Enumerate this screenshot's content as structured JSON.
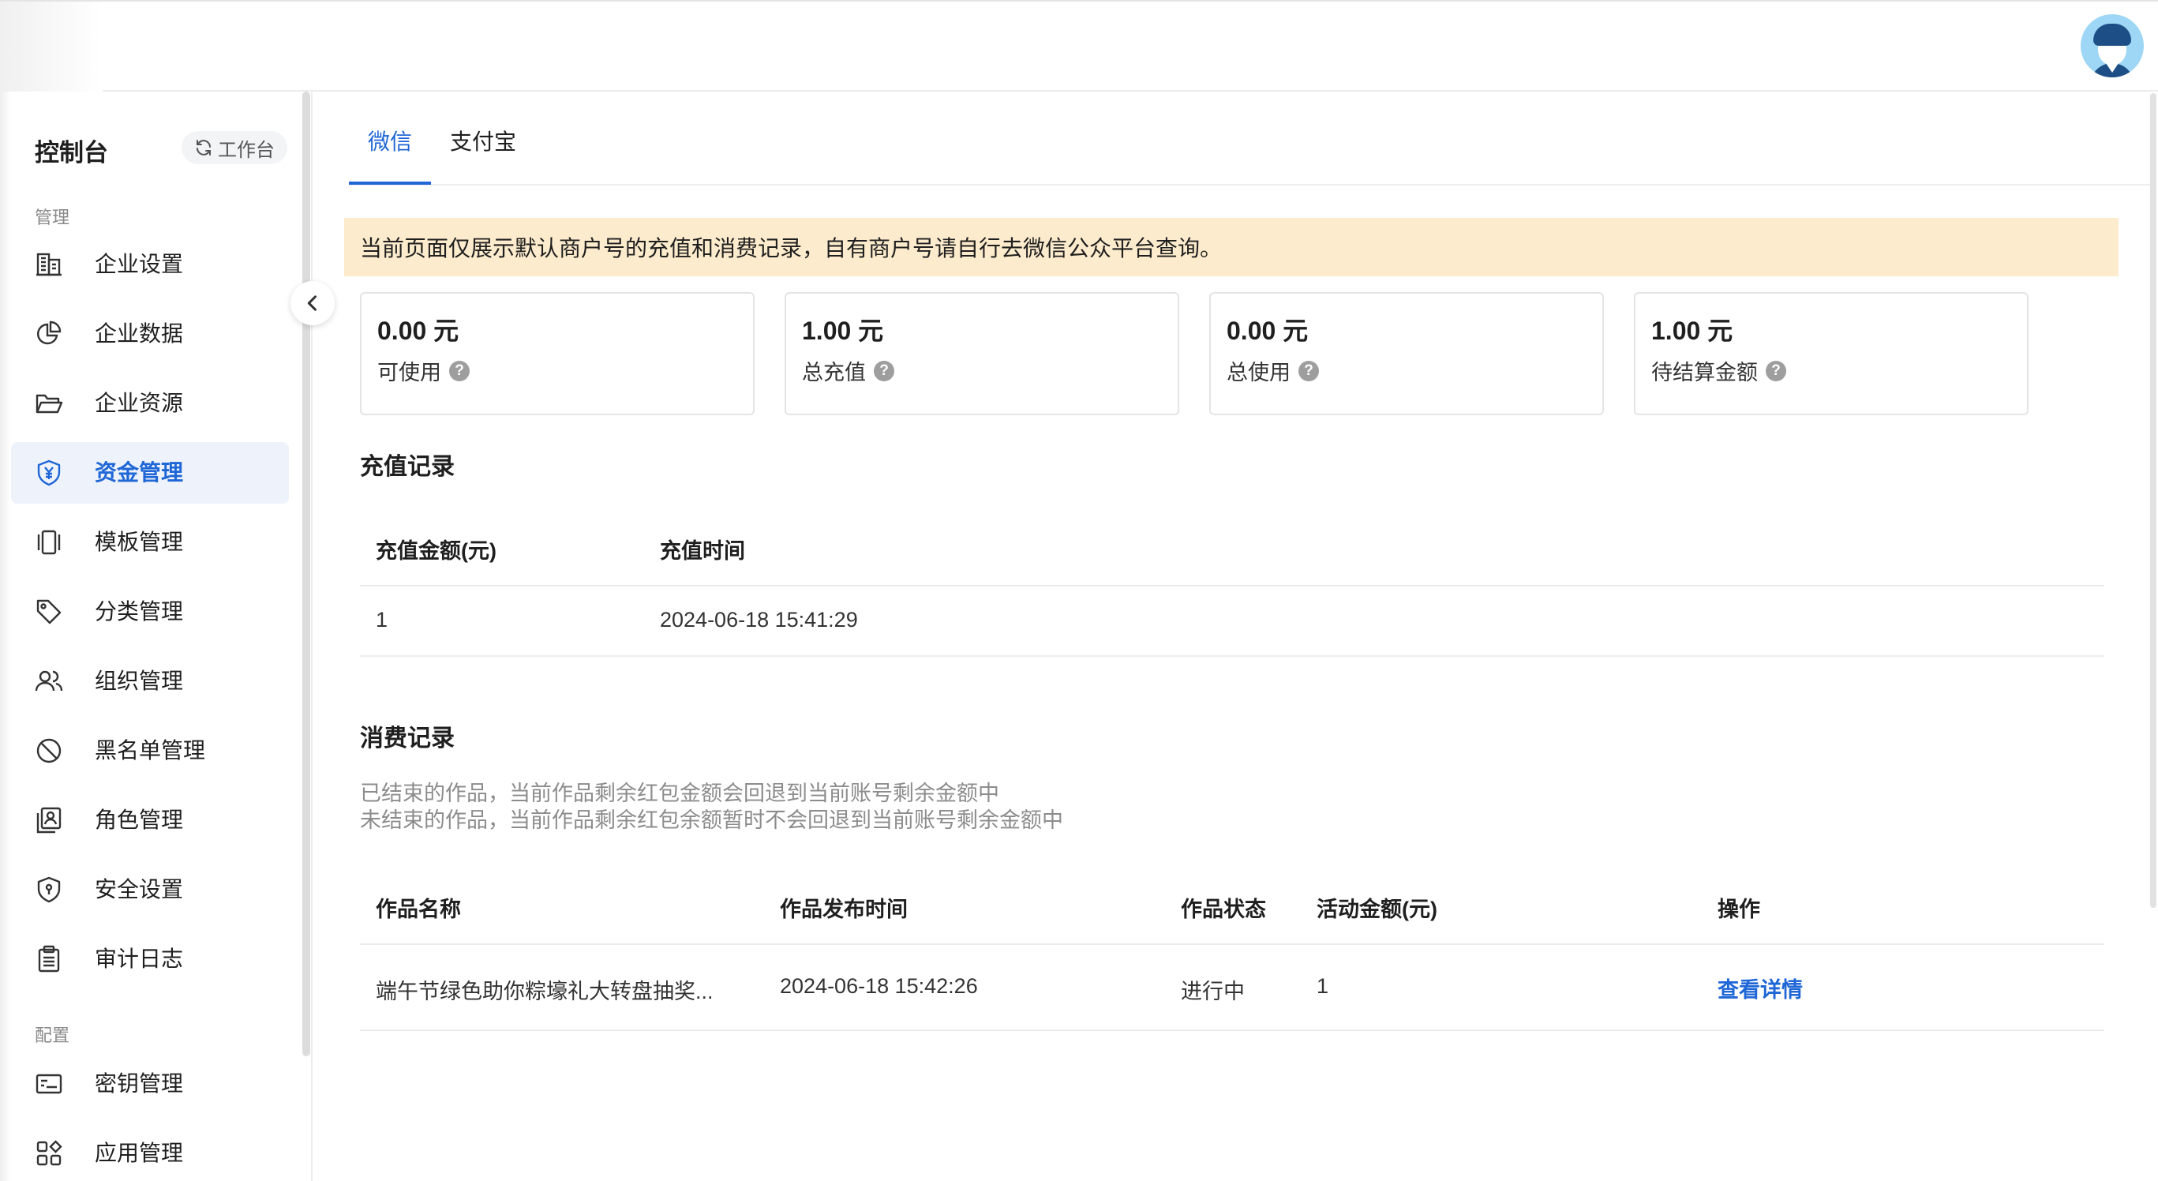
{
  "sidebar": {
    "console_title": "控制台",
    "workbench_label": "工作台",
    "groups": [
      {
        "label": "管理"
      },
      {
        "label": "配置"
      }
    ],
    "items": [
      {
        "label": "企业设置",
        "icon": "building-icon"
      },
      {
        "label": "企业数据",
        "icon": "pie-chart-icon"
      },
      {
        "label": "企业资源",
        "icon": "folder-open-icon"
      },
      {
        "label": "资金管理",
        "icon": "shield-yen-icon",
        "active": true
      },
      {
        "label": "模板管理",
        "icon": "template-icon"
      },
      {
        "label": "分类管理",
        "icon": "tag-icon"
      },
      {
        "label": "组织管理",
        "icon": "users-icon"
      },
      {
        "label": "黑名单管理",
        "icon": "ban-icon"
      },
      {
        "label": "角色管理",
        "icon": "id-badge-icon"
      },
      {
        "label": "安全设置",
        "icon": "shield-lock-icon"
      },
      {
        "label": "审计日志",
        "icon": "clipboard-icon"
      },
      {
        "label": "密钥管理",
        "icon": "key-card-icon"
      },
      {
        "label": "应用管理",
        "icon": "apps-grid-icon"
      }
    ]
  },
  "tabs": [
    {
      "label": "微信",
      "active": true
    },
    {
      "label": "支付宝",
      "active": false
    }
  ],
  "notice": "当前页面仅展示默认商户号的充值和消费记录，自有商户号请自行去微信公众平台查询。",
  "stats": [
    {
      "amount": "0.00 元",
      "label": "可使用"
    },
    {
      "amount": "1.00 元",
      "label": "总充值"
    },
    {
      "amount": "0.00 元",
      "label": "总使用"
    },
    {
      "amount": "1.00 元",
      "label": "待结算金额"
    }
  ],
  "recharge": {
    "title": "充值记录",
    "columns": [
      "充值金额(元)",
      "充值时间"
    ],
    "rows": [
      [
        "1",
        "2024-06-18 15:41:29"
      ]
    ]
  },
  "consume": {
    "title": "消费记录",
    "desc_lines": [
      "已结束的作品，当前作品剩余红包金额会回退到当前账号剩余金额中",
      "未结束的作品，当前作品剩余红包余额暂时不会回退到当前账号剩余金额中"
    ],
    "columns": [
      "作品名称",
      "作品发布时间",
      "作品状态",
      "活动金额(元)",
      "操作"
    ],
    "rows": [
      {
        "name": "端午节绿色助你粽壕礼大转盘抽奖...",
        "time": "2024-06-18 15:42:26",
        "status": "进行中",
        "amount": "1",
        "action": "查看详情"
      }
    ]
  },
  "colors": {
    "accent": "#1f66d6",
    "notice_bg": "#fcebcc",
    "active_bg": "#eef3fb"
  }
}
